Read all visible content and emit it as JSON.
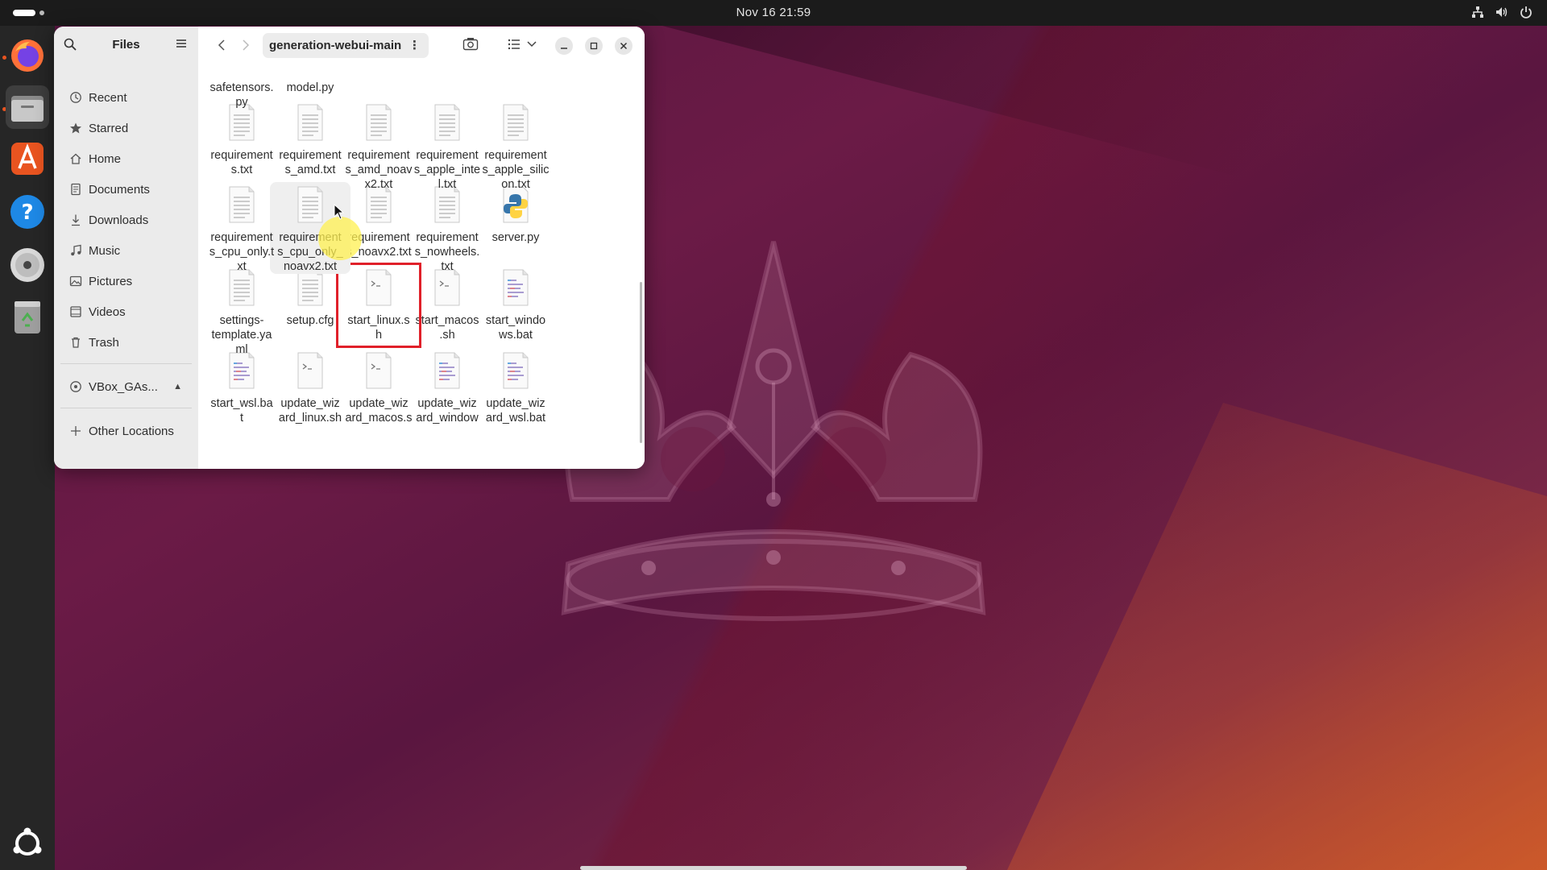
{
  "topbar": {
    "clock": "Nov 16  21:59"
  },
  "dock": {
    "apps": [
      "Firefox",
      "Files",
      "App Center",
      "Help",
      "Disc",
      "Trash"
    ]
  },
  "window": {
    "sidebar": {
      "title": "Files",
      "places": [
        {
          "label": "Recent",
          "icon": "clock-icon"
        },
        {
          "label": "Starred",
          "icon": "star-icon"
        },
        {
          "label": "Home",
          "icon": "home-icon"
        },
        {
          "label": "Documents",
          "icon": "document-icon"
        },
        {
          "label": "Downloads",
          "icon": "download-icon"
        },
        {
          "label": "Music",
          "icon": "music-icon"
        },
        {
          "label": "Pictures",
          "icon": "picture-icon"
        },
        {
          "label": "Videos",
          "icon": "video-icon"
        },
        {
          "label": "Trash",
          "icon": "trash-icon"
        }
      ],
      "devices": [
        {
          "label": "VBox_GAs...",
          "icon": "disc-icon"
        }
      ],
      "other": {
        "label": "Other Locations",
        "icon": "plus-icon"
      }
    },
    "path": "generation-webui-main",
    "files": [
      {
        "name": "safetensors.py",
        "display": "safetensors.\npy",
        "type": "text"
      },
      {
        "name": "model.py",
        "display": "model.py",
        "type": "text"
      },
      {
        "name": "requirements.txt",
        "display": "requirement\ns.txt",
        "type": "text"
      },
      {
        "name": "requirements_amd.txt",
        "display": "requirement\ns_amd.txt",
        "type": "text"
      },
      {
        "name": "requirements_amd_noavx2.txt",
        "display": "requirement\ns_amd_noav\nx2.txt",
        "type": "text"
      },
      {
        "name": "requirements_apple_intel.txt",
        "display": "requirement\ns_apple_inte\nl.txt",
        "type": "text"
      },
      {
        "name": "requirements_apple_silicon.txt",
        "display": "requirement\ns_apple_silic\non.txt",
        "type": "text"
      },
      {
        "name": "requirements_cpu_only.txt",
        "display": "requirement\ns_cpu_only.t\nxt",
        "type": "text"
      },
      {
        "name": "requirements_cpu_only_noavx2.txt",
        "display": "requirement\ns_cpu_only_\nnoavx2.txt",
        "type": "text"
      },
      {
        "name": "requirements_noavx2.txt",
        "display": "requirement\ns_noavx2.txt",
        "type": "text"
      },
      {
        "name": "requirements_nowheels.txt",
        "display": "requirement\ns_nowheels.\ntxt",
        "type": "text"
      },
      {
        "name": "server.py",
        "display": "server.py",
        "type": "python"
      },
      {
        "name": "settings-template.yaml",
        "display": "settings-\ntemplate.ya\nml",
        "type": "text"
      },
      {
        "name": "setup.cfg",
        "display": "setup.cfg",
        "type": "text"
      },
      {
        "name": "start_linux.sh",
        "display": "start_linux.s\nh",
        "type": "script"
      },
      {
        "name": "start_macos.sh",
        "display": "start_macos\n.sh",
        "type": "script"
      },
      {
        "name": "start_windows.bat",
        "display": "start_windo\nws.bat",
        "type": "bat"
      },
      {
        "name": "start_wsl.bat",
        "display": "start_wsl.ba\nt",
        "type": "bat"
      },
      {
        "name": "update_wizard_linux.sh",
        "display": "update_wiz\nard_linux.sh",
        "type": "script"
      },
      {
        "name": "update_wizard_macos.sh",
        "display": "update_wiz\nard_macos.s",
        "type": "script"
      },
      {
        "name": "update_wizard_windows.bat",
        "display": "update_wiz\nard_window",
        "type": "bat"
      },
      {
        "name": "update_wizard_wsl.bat",
        "display": "update_wiz\nard_wsl.bat",
        "type": "bat"
      }
    ],
    "highlighted_file": "start_linux.sh",
    "hovered_file": "requirements_cpu_only_noavx2.txt"
  }
}
